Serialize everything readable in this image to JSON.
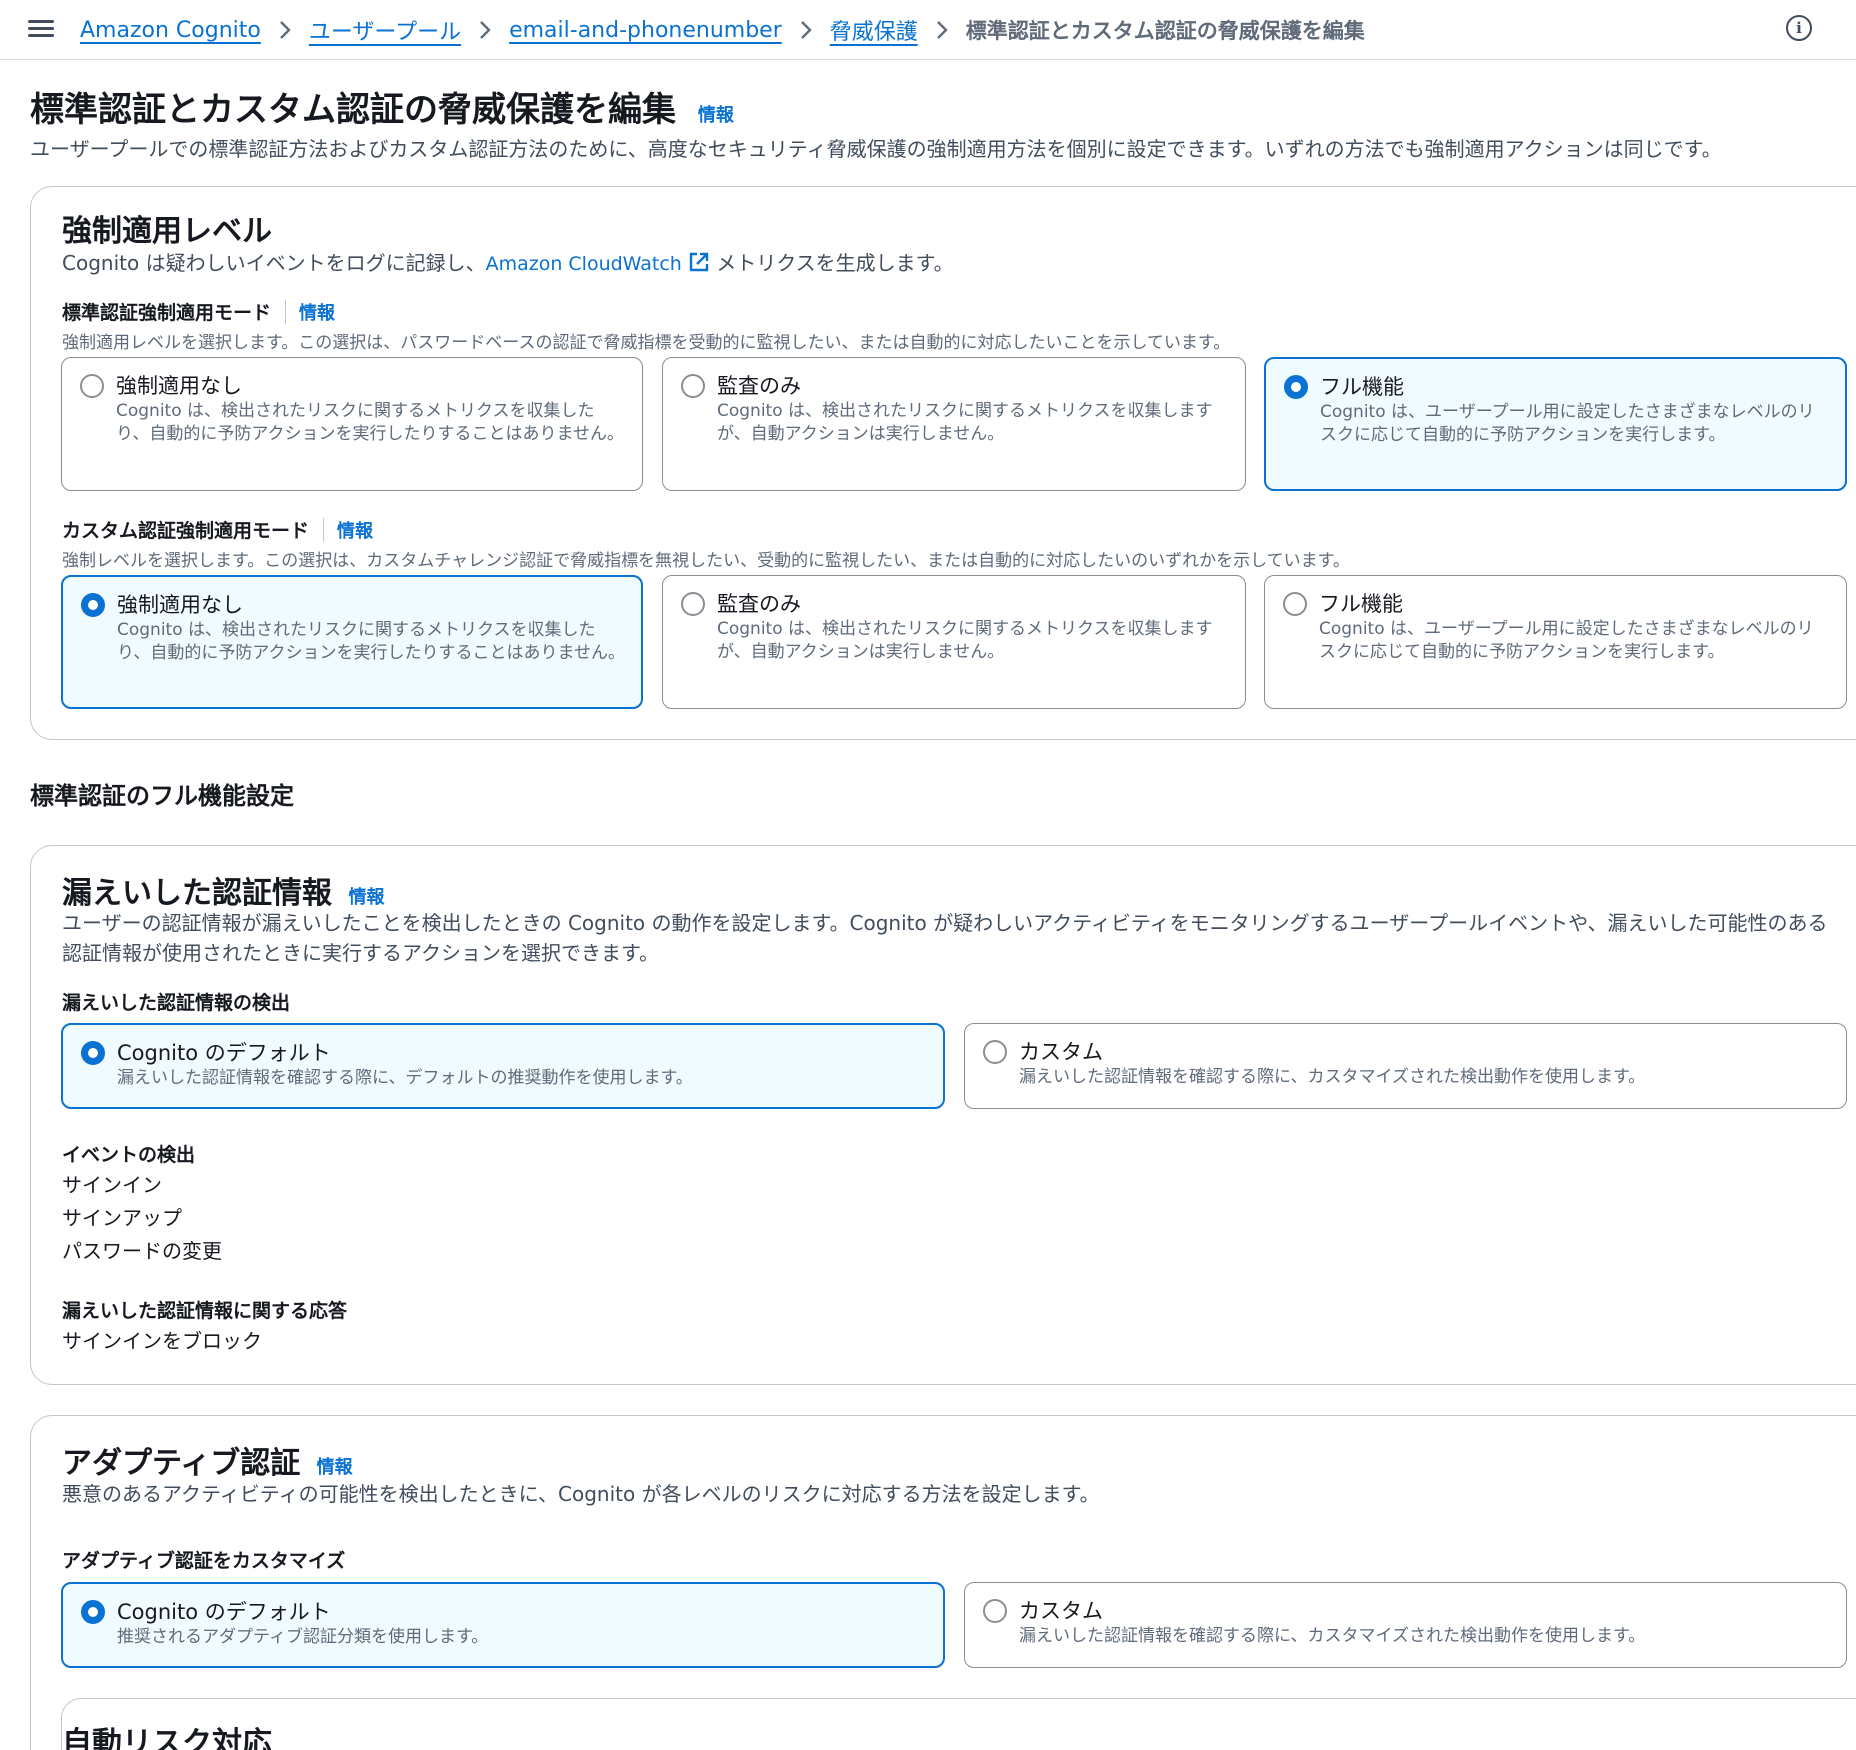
{
  "breadcrumbs": {
    "items": [
      "Amazon Cognito",
      "ユーザープール",
      "email-and-phonenumber",
      "脅威保護"
    ],
    "current": "標準認証とカスタム認証の脅威保護を編集"
  },
  "header": {
    "title": "標準認証とカスタム認証の脅威保護を編集",
    "info": "情報",
    "description": "ユーザープールでの標準認証方法およびカスタム認証方法のために、高度なセキュリティ脅威保護の強制適用方法を個別に設定できます。いずれの方法でも強制適用アクションは同じです。"
  },
  "enforcement": {
    "title": "強制適用レベル",
    "desc_prefix": "Cognito は疑わしいイベントをログに記録し、",
    "desc_link": "Amazon CloudWatch",
    "desc_suffix": "メトリクスを生成します。",
    "standard": {
      "label": "標準認証強制適用モード",
      "info": "情報",
      "desc": "強制適用レベルを選択します。この選択は、パスワードベースの認証で脅威指標を受動的に監視したい、または自動的に対応したいことを示しています。",
      "options": [
        {
          "title": "強制適用なし",
          "desc": "Cognito は、検出されたリスクに関するメトリクスを収集したり、自動的に予防アクションを実行したりすることはありません。"
        },
        {
          "title": "監査のみ",
          "desc": "Cognito は、検出されたリスクに関するメトリクスを収集しますが、自動アクションは実行しません。"
        },
        {
          "title": "フル機能",
          "desc": "Cognito は、ユーザープール用に設定したさまざまなレベルのリスクに応じて自動的に予防アクションを実行します。"
        }
      ],
      "selected": 2
    },
    "custom": {
      "label": "カスタム認証強制適用モード",
      "info": "情報",
      "desc": "強制レベルを選択します。この選択は、カスタムチャレンジ認証で脅威指標を無視したい、受動的に監視したい、または自動的に対応したいのいずれかを示しています。",
      "options": [
        {
          "title": "強制適用なし",
          "desc": "Cognito は、検出されたリスクに関するメトリクスを収集したり、自動的に予防アクションを実行したりすることはありません。"
        },
        {
          "title": "監査のみ",
          "desc": "Cognito は、検出されたリスクに関するメトリクスを収集しますが、自動アクションは実行しません。"
        },
        {
          "title": "フル機能",
          "desc": "Cognito は、ユーザープール用に設定したさまざまなレベルのリスクに応じて自動的に予防アクションを実行します。"
        }
      ],
      "selected": 0
    }
  },
  "full_settings_heading": "標準認証のフル機能設定",
  "leaked": {
    "title": "漏えいした認証情報",
    "info": "情報",
    "desc": "ユーザーの認証情報が漏えいしたことを検出したときの Cognito の動作を設定します。Cognito が疑わしいアクティビティをモニタリングするユーザープールイベントや、漏えいした可能性のある認証情報が使用されたときに実行するアクションを選択できます。",
    "detection_label": "漏えいした認証情報の検出",
    "options": [
      {
        "title": "Cognito のデフォルト",
        "desc": "漏えいした認証情報を確認する際に、デフォルトの推奨動作を使用します。"
      },
      {
        "title": "カスタム",
        "desc": "漏えいした認証情報を確認する際に、カスタマイズされた検出動作を使用します。"
      }
    ],
    "selected": 0,
    "events_label": "イベントの検出",
    "events": [
      "サインイン",
      "サインアップ",
      "パスワードの変更"
    ],
    "response_label": "漏えいした認証情報に関する応答",
    "response_value": "サインインをブロック"
  },
  "adaptive": {
    "title": "アダプティブ認証",
    "info": "情報",
    "desc": "悪意のあるアクティビティの可能性を検出したときに、Cognito が各レベルのリスクに対応する方法を設定します。",
    "customize_label": "アダプティブ認証をカスタマイズ",
    "options": [
      {
        "title": "Cognito のデフォルト",
        "desc": "推奨されるアダプティブ認証分類を使用します。"
      },
      {
        "title": "カスタム",
        "desc": "漏えいした認証情報を確認する際に、カスタマイズされた検出動作を使用します。"
      }
    ],
    "selected": 0,
    "auto_risk_title": "自動リスク対応"
  },
  "colors": {
    "accent": "#0972d3",
    "selected_bg": "#f0fbff",
    "text": "#16191f",
    "muted": "#5f6b7a"
  },
  "icons": {
    "menu": "hamburger-icon",
    "separator": "chevron-right-icon",
    "help": "info-circle-icon",
    "external": "external-link-icon"
  }
}
